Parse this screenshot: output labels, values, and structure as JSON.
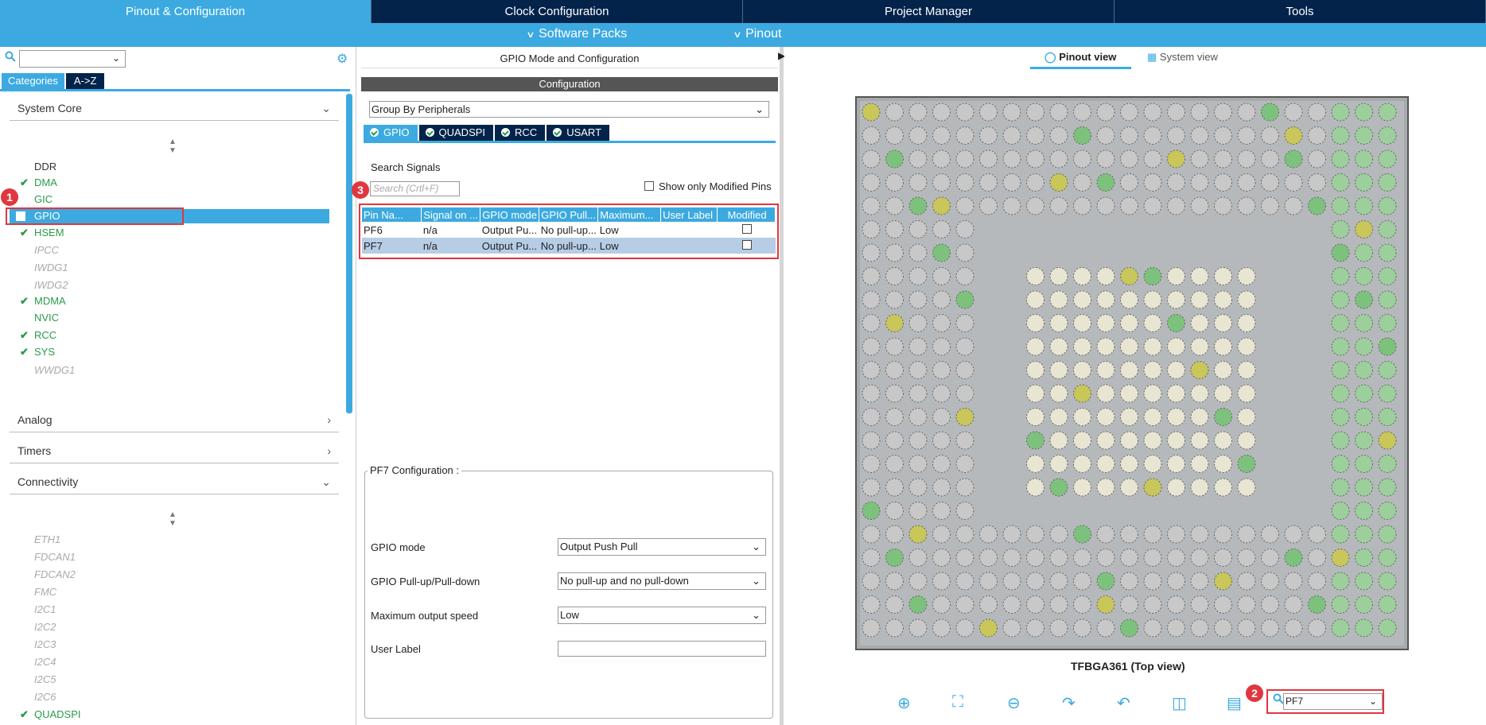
{
  "top_tabs": [
    "Pinout & Configuration",
    "Clock Configuration",
    "Project Manager",
    "Tools"
  ],
  "sub_bar": {
    "software_packs": "Software Packs",
    "pinout": "Pinout"
  },
  "left": {
    "category_tabs": [
      "Categories",
      "A->Z"
    ],
    "system_core": {
      "title": "System Core",
      "items": [
        {
          "label": "DDR",
          "state": "plain"
        },
        {
          "label": "DMA",
          "state": "ok"
        },
        {
          "label": "GIC",
          "state": "plain-green"
        },
        {
          "label": "GPIO",
          "state": "selected"
        },
        {
          "label": "HSEM",
          "state": "ok"
        },
        {
          "label": "IPCC",
          "state": "dim"
        },
        {
          "label": "IWDG1",
          "state": "dim"
        },
        {
          "label": "IWDG2",
          "state": "dim"
        },
        {
          "label": "MDMA",
          "state": "ok"
        },
        {
          "label": "NVIC",
          "state": "plain-green"
        },
        {
          "label": "RCC",
          "state": "ok"
        },
        {
          "label": "SYS",
          "state": "ok"
        },
        {
          "label": "WWDG1",
          "state": "dim"
        }
      ]
    },
    "groups": [
      "Analog",
      "Timers",
      "Connectivity"
    ],
    "connectivity_items": [
      {
        "label": "ETH1",
        "state": "dim"
      },
      {
        "label": "FDCAN1",
        "state": "dim"
      },
      {
        "label": "FDCAN2",
        "state": "dim"
      },
      {
        "label": "FMC",
        "state": "dim"
      },
      {
        "label": "I2C1",
        "state": "dim"
      },
      {
        "label": "I2C2",
        "state": "dim"
      },
      {
        "label": "I2C3",
        "state": "dim"
      },
      {
        "label": "I2C4",
        "state": "dim"
      },
      {
        "label": "I2C5",
        "state": "dim"
      },
      {
        "label": "I2C6",
        "state": "dim"
      },
      {
        "label": "QUADSPI",
        "state": "ok"
      }
    ]
  },
  "middle": {
    "title": "GPIO Mode and Configuration",
    "config_bar": "Configuration",
    "group_by": "Group By Peripherals",
    "peripheral_tabs": [
      "GPIO",
      "QUADSPI",
      "RCC",
      "USART"
    ],
    "search_label": "Search Signals",
    "search_placeholder": "Search (Crtl+F)",
    "show_modified": "Show only Modified Pins",
    "table_headers": [
      "Pin Na...",
      "Signal on ...",
      "GPIO mode",
      "GPIO Pull...",
      "Maximum...",
      "User Label",
      "Modified"
    ],
    "rows": [
      [
        "PF6",
        "n/a",
        "Output Pu...",
        "No pull-up...",
        "Low",
        ""
      ],
      [
        "PF7",
        "n/a",
        "Output Pu...",
        "No pull-up...",
        "Low",
        ""
      ]
    ],
    "pf7_title": "PF7 Configuration :",
    "fields": [
      {
        "label": "GPIO mode",
        "value": "Output Push Pull"
      },
      {
        "label": "GPIO Pull-up/Pull-down",
        "value": "No pull-up and no pull-down"
      },
      {
        "label": "Maximum output speed",
        "value": "Low"
      },
      {
        "label": "User Label",
        "value": ""
      }
    ]
  },
  "right": {
    "pinout_view": "Pinout view",
    "system_view": "System view",
    "chip_label": "TFBGA361 (Top view)",
    "pin_search_value": "PF7"
  },
  "badges": [
    "1",
    "2",
    "3"
  ],
  "colors": {
    "navy": "#03234b",
    "accent": "#3caae0",
    "ok_green": "#2a9b4a",
    "badge_red": "#e0373e"
  }
}
